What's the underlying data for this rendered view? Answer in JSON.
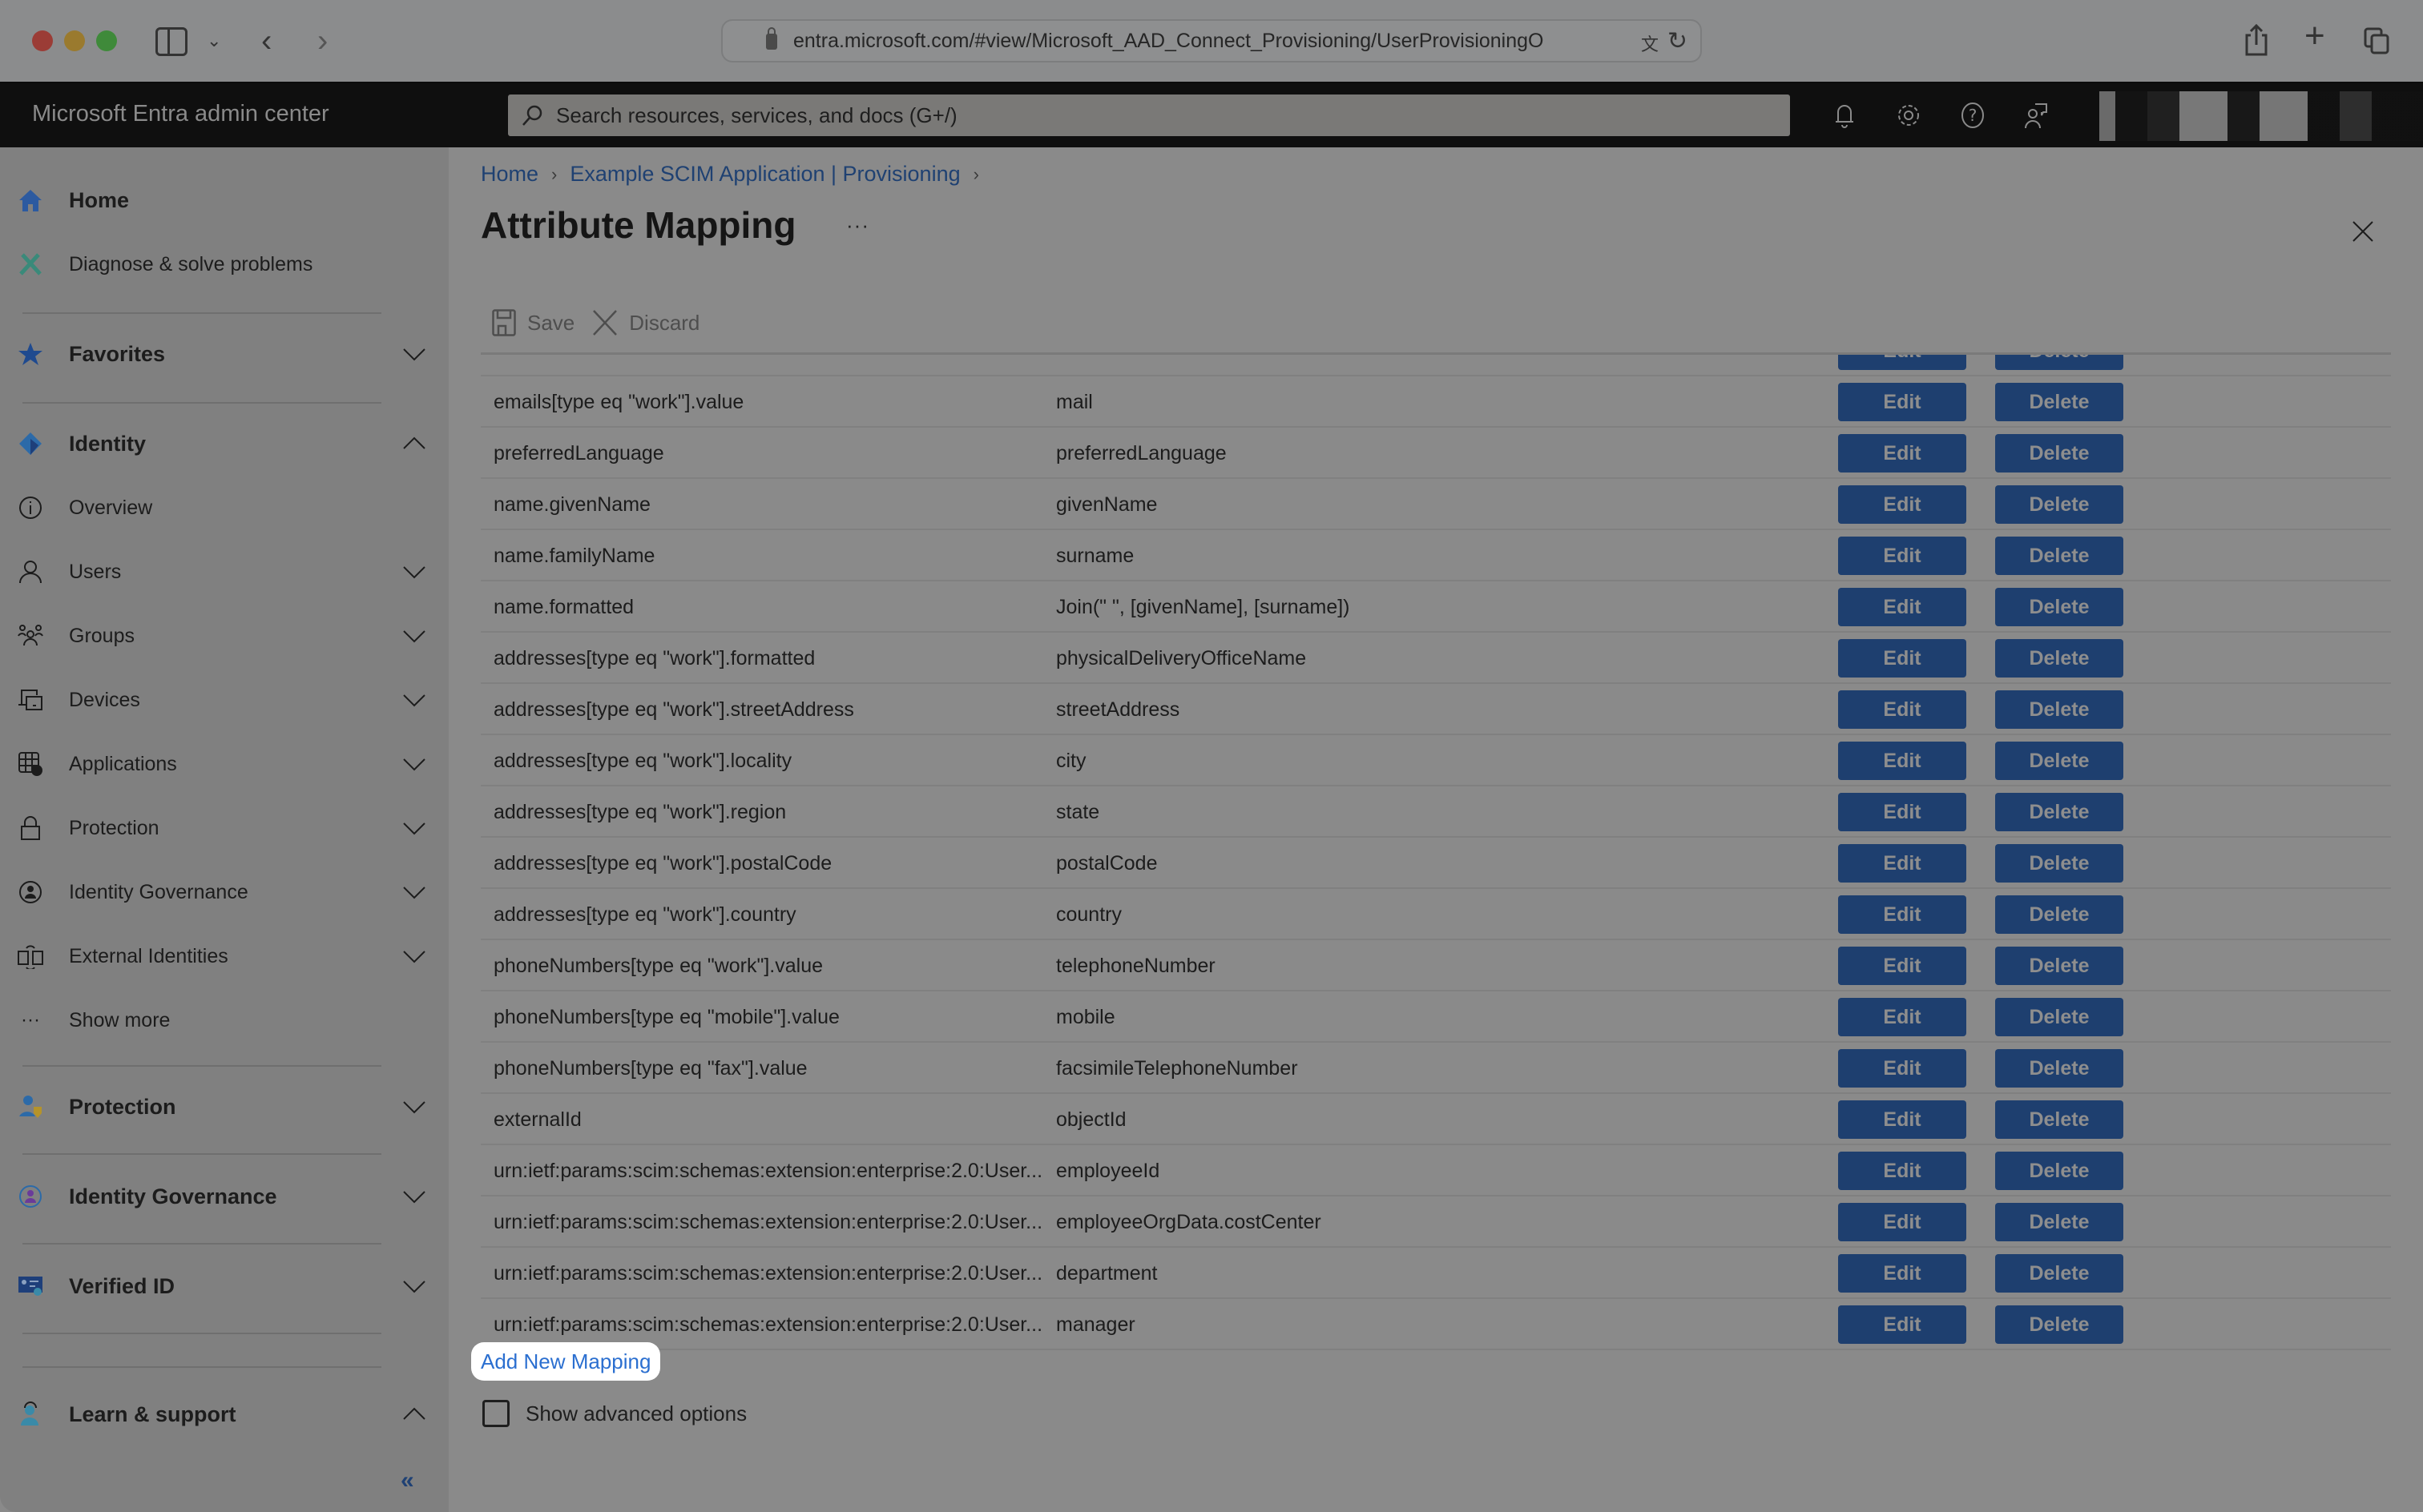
{
  "browser": {
    "url": "entra.microsoft.com/#view/Microsoft_AAD_Connect_Provisioning/UserProvisioningO",
    "icons": [
      "sidebar-toggle-icon",
      "chevron-down-icon",
      "back-icon",
      "forward-icon",
      "lock-icon",
      "translate-icon",
      "reload-icon",
      "share-icon",
      "plus-icon",
      "tabs-icon"
    ]
  },
  "topbar": {
    "brand": "Microsoft Entra admin center",
    "search_placeholder": "Search resources, services, and docs (G+/)",
    "icons": [
      "bell-icon",
      "gear-icon",
      "help-icon",
      "feedback-icon"
    ]
  },
  "sidebar": {
    "items": [
      {
        "label": "Home",
        "icon": "home-icon"
      },
      {
        "label": "Diagnose & solve problems",
        "icon": "wrench-icon"
      },
      {
        "label": "Favorites",
        "icon": "star-icon",
        "expanded": false
      },
      {
        "label": "Identity",
        "icon": "identity-icon",
        "expanded": true
      },
      {
        "label": "Overview",
        "icon": "info-icon"
      },
      {
        "label": "Users",
        "icon": "user-icon",
        "expanded": false
      },
      {
        "label": "Groups",
        "icon": "groups-icon",
        "expanded": false
      },
      {
        "label": "Devices",
        "icon": "devices-icon",
        "expanded": false
      },
      {
        "label": "Applications",
        "icon": "applications-icon",
        "expanded": false
      },
      {
        "label": "Protection",
        "icon": "lock-icon",
        "expanded": false
      },
      {
        "label": "Identity Governance",
        "icon": "governance-icon",
        "expanded": false
      },
      {
        "label": "External Identities",
        "icon": "external-identities-icon",
        "expanded": false
      },
      {
        "label": "Show more",
        "icon": "ellipsis-icon"
      },
      {
        "label": "Protection",
        "icon": "protection-shield-icon",
        "expanded": false
      },
      {
        "label": "Identity Governance",
        "icon": "identity-governance-icon",
        "expanded": false
      },
      {
        "label": "Verified ID",
        "icon": "verified-id-icon",
        "expanded": false
      },
      {
        "label": "Learn & support",
        "icon": "support-icon",
        "expanded": true
      }
    ],
    "collapse_label": "«"
  },
  "main": {
    "breadcrumb": [
      "Home",
      "Example SCIM Application | Provisioning"
    ],
    "title": "Attribute Mapping",
    "more_label": "···",
    "toolbar": {
      "save_label": "Save",
      "discard_label": "Discard"
    },
    "edit_label": "Edit",
    "delete_label": "Delete",
    "rows": [
      {
        "target": "",
        "source": ""
      },
      {
        "target": "emails[type eq \"work\"].value",
        "source": "mail"
      },
      {
        "target": "preferredLanguage",
        "source": "preferredLanguage"
      },
      {
        "target": "name.givenName",
        "source": "givenName"
      },
      {
        "target": "name.familyName",
        "source": "surname"
      },
      {
        "target": "name.formatted",
        "source": "Join(\" \", [givenName], [surname])"
      },
      {
        "target": "addresses[type eq \"work\"].formatted",
        "source": "physicalDeliveryOfficeName"
      },
      {
        "target": "addresses[type eq \"work\"].streetAddress",
        "source": "streetAddress"
      },
      {
        "target": "addresses[type eq \"work\"].locality",
        "source": "city"
      },
      {
        "target": "addresses[type eq \"work\"].region",
        "source": "state"
      },
      {
        "target": "addresses[type eq \"work\"].postalCode",
        "source": "postalCode"
      },
      {
        "target": "addresses[type eq \"work\"].country",
        "source": "country"
      },
      {
        "target": "phoneNumbers[type eq \"work\"].value",
        "source": "telephoneNumber"
      },
      {
        "target": "phoneNumbers[type eq \"mobile\"].value",
        "source": "mobile"
      },
      {
        "target": "phoneNumbers[type eq \"fax\"].value",
        "source": "facsimileTelephoneNumber"
      },
      {
        "target": "externalId",
        "source": "objectId"
      },
      {
        "target": "urn:ietf:params:scim:schemas:extension:enterprise:2.0:User...",
        "source": "employeeId"
      },
      {
        "target": "urn:ietf:params:scim:schemas:extension:enterprise:2.0:User...",
        "source": "employeeOrgData.costCenter"
      },
      {
        "target": "urn:ietf:params:scim:schemas:extension:enterprise:2.0:User...",
        "source": "department"
      },
      {
        "target": "urn:ietf:params:scim:schemas:extension:enterprise:2.0:User...",
        "source": "manager"
      }
    ],
    "add_mapping_label": "Add New Mapping",
    "advanced_options_label": "Show advanced options",
    "advanced_options_checked": false
  },
  "colors": {
    "button_bg": "#1e3f6f",
    "link": "#2b6fd0",
    "breadcrumb": "#1f4172",
    "overlay_bg": "#8a8a8a",
    "topbar_bg": "#0f0f0f"
  }
}
